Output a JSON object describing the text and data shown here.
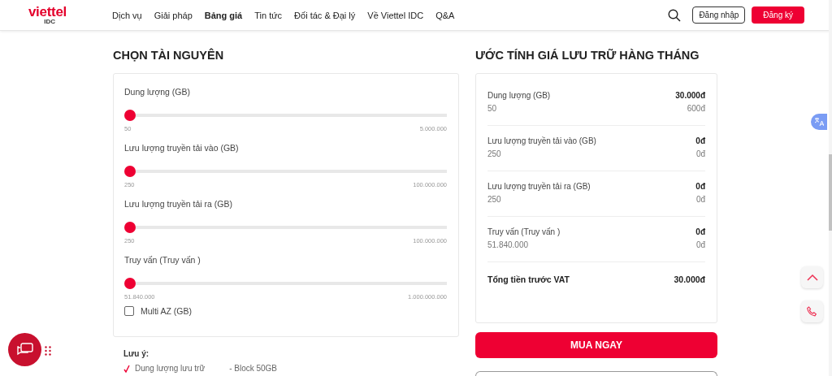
{
  "header": {
    "logo": {
      "brand": "viettel",
      "sub": "IDC"
    },
    "nav": [
      {
        "label": "Dịch vụ",
        "selected": false
      },
      {
        "label": "Giải pháp",
        "selected": false
      },
      {
        "label": "Bảng giá",
        "selected": true
      },
      {
        "label": "Tin tức",
        "selected": false
      },
      {
        "label": "Đối tác & Đại lý",
        "selected": false
      },
      {
        "label": "Về Viettel IDC",
        "selected": false
      },
      {
        "label": "Q&A",
        "selected": false
      }
    ],
    "login": "Đăng nhập",
    "register": "Đăng ký"
  },
  "resources": {
    "title": "CHỌN TÀI NGUYÊN",
    "sliders": [
      {
        "label": "Dung lượng (GB)",
        "level": 0,
        "min": "50",
        "max": "5.000.000"
      },
      {
        "label": "Lưu lượng truyền tải vào (GB)",
        "level": 0,
        "min": "250",
        "max": "100.000.000"
      },
      {
        "label": "Lưu lượng truyền tải ra (GB)",
        "level": 0,
        "min": "250",
        "max": "100.000.000"
      },
      {
        "label": "Truy vấn (Truy vấn )",
        "level": 0,
        "min": "51.840.000",
        "max": "1.000.000.000"
      }
    ],
    "multi_az": {
      "label": "Multi AZ (GB)",
      "checked": false
    },
    "note": {
      "title": "Lưu ý:",
      "items": [
        {
          "name": "Dung lượng lưu trữ",
          "value": "- Block 50GB"
        }
      ]
    }
  },
  "estimate": {
    "title": "ƯỚC TÍNH GIÁ LƯU TRỮ HÀNG THÁNG",
    "rows": [
      {
        "label": "Dung lượng (GB)",
        "price": "30.000đ",
        "amount": "50",
        "unit_price": "600đ"
      },
      {
        "label": "Lưu lượng truyền tải vào (GB)",
        "price": "0đ",
        "amount": "250",
        "unit_price": "0đ"
      },
      {
        "label": "Lưu lượng truyền tải ra (GB)",
        "price": "0đ",
        "amount": "250",
        "unit_price": "0đ"
      },
      {
        "label": "Truy vấn (Truy vấn )",
        "price": "0đ",
        "amount": "51.840.000",
        "unit_price": "0đ"
      }
    ],
    "total_label": "Tổng tiền trước VAT",
    "total": "30.000đ",
    "buy": "MUA NGAY"
  }
}
